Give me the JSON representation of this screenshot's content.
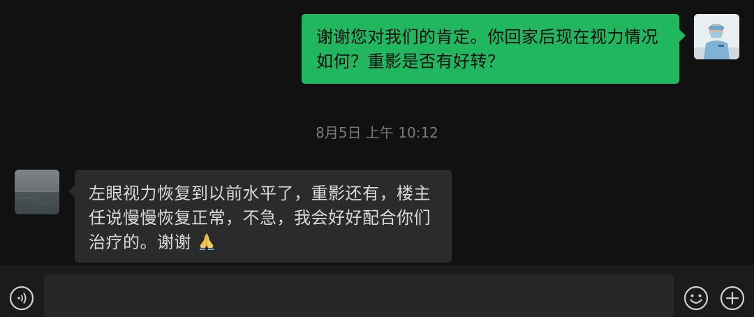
{
  "messages": {
    "outgoing": {
      "text": "谢谢您对我们的肯定。你回家后现在视力情况如何？重影是否有好转？"
    },
    "timestamp": "8月5日 上午 10:12",
    "incoming": {
      "text": "左眼视力恢复到以前水平了，重影还有，楼主任说慢慢恢复正常，不急，我会好好配合你们治疗的。谢谢",
      "emoji": "folded-hands-icon"
    }
  },
  "input_bar": {
    "value": "",
    "placeholder": "",
    "icons": [
      "voice-icon",
      "emoji-icon",
      "plus-icon"
    ]
  },
  "colors": {
    "background": "#111111",
    "outgoing_bubble": "#20b75f",
    "incoming_bubble": "#2b2b2b",
    "timestamp": "#7a7a7a"
  }
}
